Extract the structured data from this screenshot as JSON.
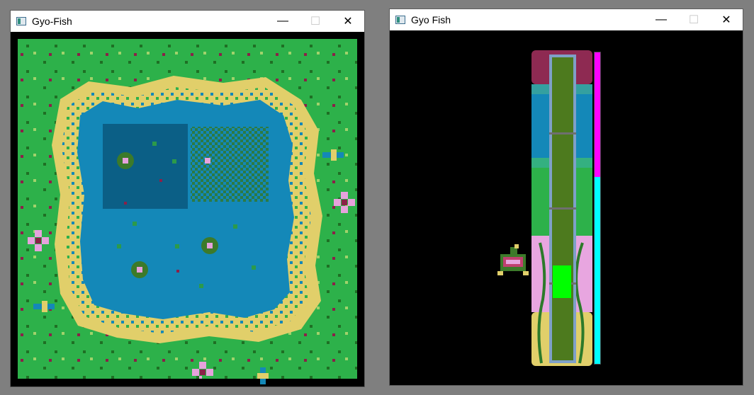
{
  "windows": [
    {
      "title": "Gyo-Fish",
      "controls": {
        "minimize": "—",
        "maximize": "☐",
        "close": "✕"
      }
    },
    {
      "title": "Gyo Fish",
      "controls": {
        "minimize": "—",
        "maximize": "☐",
        "close": "✕"
      }
    }
  ],
  "colors": {
    "desktop": "#7f7f7f",
    "grass": "#2db14a",
    "grass_dark": "#1f6f24",
    "sand": "#e1cf6a",
    "water": "#1488b8",
    "water_deep": "#0b5f86",
    "lily": "#3c7a2a",
    "flower": "#e6a2dc",
    "meter_magenta": "#ff00ff",
    "meter_cyan": "#00ffff",
    "catch_box": "#00ff00"
  },
  "icons": {
    "app": "window-app-icon",
    "fish": "pixel-fish-icon"
  },
  "fishing": {
    "progress_fraction": 0.6,
    "catch_zone_fraction": 0.2
  }
}
